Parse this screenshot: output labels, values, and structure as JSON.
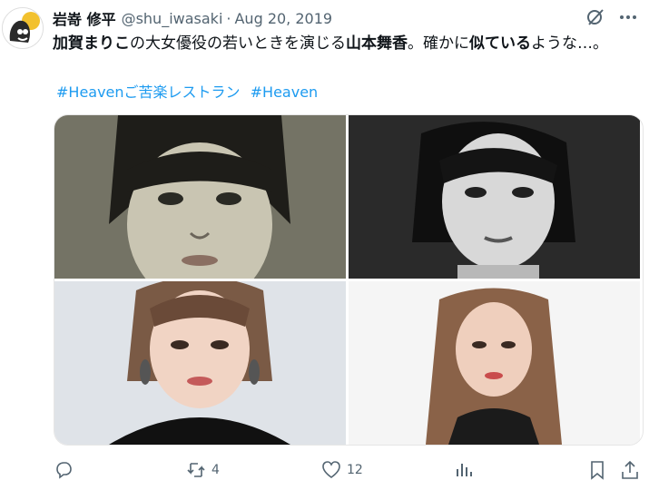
{
  "tweet": {
    "author_name": "岩嵜 修平",
    "handle": "@shu_iwasaki",
    "separator": "·",
    "date": "Aug 20, 2019",
    "text_parts": [
      {
        "t": "加賀まりこ",
        "bold": true
      },
      {
        "t": "の大女優役の若いときを演じる",
        "bold": false
      },
      {
        "t": "山本舞香",
        "bold": true
      },
      {
        "t": "。確かに",
        "bold": false
      },
      {
        "t": "似ている",
        "bold": true
      },
      {
        "t": "ような…。",
        "bold": false
      }
    ],
    "hashtags": [
      "#Heavenご苦楽レストラン",
      "#Heaven"
    ]
  },
  "header_icons": [
    "grok-icon",
    "more-icon"
  ],
  "media": [
    {
      "name": "photo-top-left",
      "tone": "sepia"
    },
    {
      "name": "photo-top-right",
      "tone": "bw"
    },
    {
      "name": "photo-bottom-left",
      "tone": "color-gray"
    },
    {
      "name": "photo-bottom-right",
      "tone": "color-white"
    }
  ],
  "actions": {
    "reply_count": "",
    "retweet_count": "4",
    "like_count": "12",
    "views_count": ""
  },
  "colors": {
    "link": "#1d9bf0",
    "muted": "#536471"
  }
}
